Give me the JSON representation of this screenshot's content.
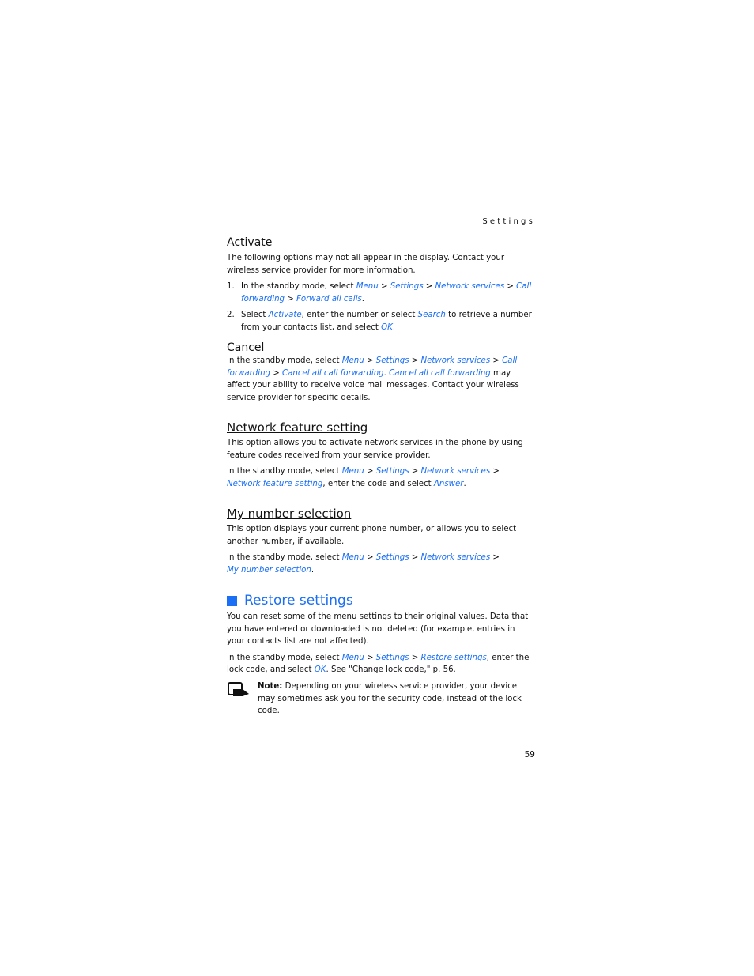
{
  "header": {
    "running_title": "Settings"
  },
  "activate": {
    "heading": "Activate",
    "intro": "The following options may not all appear in the display. Contact your wireless service provider for more information.",
    "steps": [
      {
        "num": "1.",
        "t1": "In the standby mode, select ",
        "l1": "Menu",
        "s1": " > ",
        "l2": "Settings",
        "s2": " > ",
        "l3": "Network services",
        "s3": " > ",
        "l4": "Call forwarding",
        "s4": " > ",
        "l5": "Forward all calls",
        "end": "."
      },
      {
        "num": "2.",
        "t1": "Select ",
        "l1": "Activate",
        "t2": ", enter the number or select ",
        "l2": "Search",
        "t3": " to retrieve a number from your contacts list, and select ",
        "l3": "OK",
        "end": "."
      }
    ]
  },
  "cancel": {
    "heading": "Cancel",
    "t1": "In the standby mode, select ",
    "l1": "Menu",
    "s1": " > ",
    "l2": "Settings",
    "s2": " > ",
    "l3": "Network services",
    "s3": " > ",
    "l4": "Call forwarding",
    "s4": " > ",
    "l5": "Cancel all call forwarding",
    "t2": ". ",
    "l6": "Cancel all call forwarding",
    "t3": " may affect your ability to receive voice mail messages. Contact your wireless service provider for specific details."
  },
  "network_feature": {
    "heading": "Network feature setting",
    "intro": "This option allows you to activate network services in the phone by using feature codes received from your service provider.",
    "t1": "In the standby mode, select ",
    "l1": "Menu",
    "s1": " > ",
    "l2": "Settings",
    "s2": " > ",
    "l3": "Network services",
    "s3": " > ",
    "l4": "Network feature setting",
    "t2": ", enter the code and select ",
    "l5": "Answer",
    "end": "."
  },
  "my_number": {
    "heading": "My number selection",
    "intro": "This option displays your current phone number, or allows you to select another number, if available.",
    "t1": "In the standby mode, select ",
    "l1": "Menu",
    "s1": " > ",
    "l2": "Settings",
    "s2": " > ",
    "l3": "Network services",
    "s3": " > ",
    "l4": "My number selection",
    "end": "."
  },
  "restore": {
    "heading": "Restore settings",
    "intro": "You can reset some of the menu settings to their original values. Data that you have entered or downloaded is not deleted (for example, entries in your contacts list are not affected).",
    "t1": "In the standby mode, select ",
    "l1": "Menu",
    "s1": " > ",
    "l2": "Settings",
    "s2": " > ",
    "l3": "Restore settings",
    "t2": ", enter the lock code, and select ",
    "l4": "OK",
    "t3": ". See \"Change lock code,\" p. 56.",
    "note_label": "Note:",
    "note_text": " Depending on your wireless service provider, your device may sometimes ask you for the security code, instead of the lock code.",
    "note_icon": "note-hand-icon"
  },
  "footer": {
    "page_number": "59"
  },
  "colors": {
    "link": "#1a6ff5",
    "text": "#111111"
  }
}
